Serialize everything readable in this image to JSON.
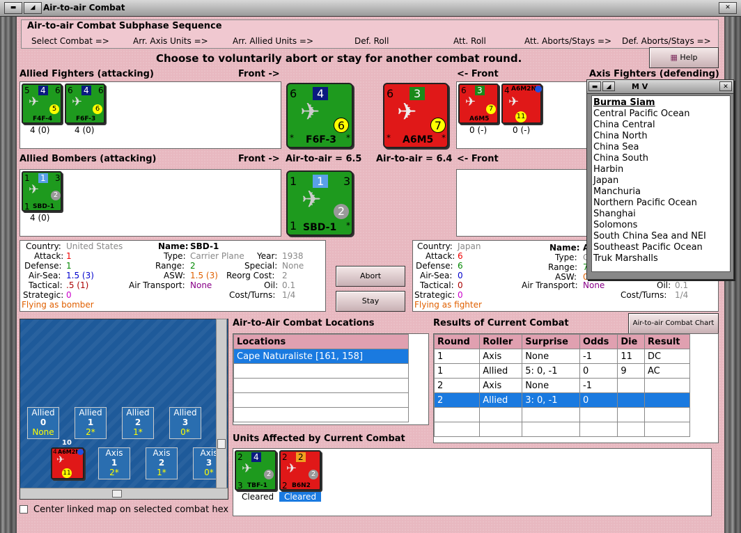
{
  "window": {
    "title": "Air-to-air Combat"
  },
  "subphase": {
    "title": "Air-to-air Combat Subphase Sequence",
    "steps": [
      "Select Combat =>",
      "Arr. Axis Units =>",
      "Arr. Allied Units =>",
      "Def. Roll",
      "Att. Roll",
      "Att. Aborts/Stays =>",
      "Def. Aborts/Stays =>"
    ]
  },
  "prompt": "Choose to voluntarily abort or stay for another combat round.",
  "help_label": "Help",
  "allied_fighters": {
    "label": "Allied Fighters (attacking)",
    "front": "Front ->",
    "units": [
      {
        "name": "F4F-4",
        "tl": "5",
        "tr": "6",
        "badge": "4",
        "circle": "5",
        "count": "4 (0)"
      },
      {
        "name": "F6F-3",
        "tl": "6",
        "tr": "6",
        "badge": "4",
        "circle": "6",
        "count": "4 (0)"
      }
    ],
    "front_unit": {
      "name": "F6F-3",
      "tl": "6",
      "badge": "4",
      "circle": "6",
      "bl": "*",
      "br": "*"
    }
  },
  "axis_fighters": {
    "label": "Axis Fighters (defending)",
    "front": "<- Front",
    "units": [
      {
        "name": "A6M5",
        "tl": "6",
        "badge": "3",
        "circle": "7",
        "count": "0 (-)"
      },
      {
        "name": "A6M2N",
        "tl": "4",
        "circle": "11",
        "count": "0 (-)"
      }
    ],
    "front_unit": {
      "name": "A6M5",
      "tl": "6",
      "badge": "3",
      "circle": "7",
      "bl": "*",
      "br": "*"
    }
  },
  "allied_bombers": {
    "label": "Allied Bombers (attacking)",
    "front": "Front ->",
    "air_to_air": "Air-to-air = 6.5",
    "units": [
      {
        "name": "SBD-1",
        "tl": "1",
        "tr": "3",
        "badge": "1",
        "circle": "2",
        "bl": "1",
        "count": "4 (0)"
      }
    ],
    "front_unit": {
      "name": "SBD-1",
      "tl": "1",
      "tr": "3",
      "badge": "1",
      "circle": "2",
      "bl": "1",
      "br": "*"
    }
  },
  "axis_bombers": {
    "front": "<- Front",
    "air_to_air": "Air-to-air = 6.4"
  },
  "allied_info": {
    "country_label": "Country:",
    "country": "United States",
    "attack_label": "Attack:",
    "attack": "1",
    "defense_label": "Defense:",
    "defense": "1",
    "airsea_label": "Air-Sea:",
    "airsea": "1.5 (3)",
    "tactical_label": "Tactical:",
    "tactical": ".5 (1)",
    "strategic_label": "Strategic:",
    "strategic": "0",
    "flying": "Flying as bomber",
    "name_label": "Name:",
    "name": "SBD-1",
    "type_label": "Type:",
    "type": "Carrier Plane",
    "range_label": "Range:",
    "range": "2",
    "asw_label": "ASW:",
    "asw": "1.5 (3)",
    "air_transport_label": "Air Transport:",
    "air_transport": "None",
    "year_label": "Year:",
    "year": "1938",
    "special_label": "Special:",
    "special": "None",
    "reorg_label": "Reorg Cost:",
    "reorg": "2",
    "oil_label": "Oil:",
    "oil": "0.1",
    "cost_label": "Cost/Turns:",
    "cost": "1/4"
  },
  "axis_info": {
    "country_label": "Country:",
    "country": "Japan",
    "attack_label": "Attack:",
    "attack": "6",
    "defense_label": "Defense:",
    "defense": "6",
    "airsea_label": "Air-Sea:",
    "airsea": "0",
    "tactical_label": "Tactical:",
    "tactical": "0",
    "strategic_label": "Strategic:",
    "strategic": "0",
    "flying": "Flying as fighter",
    "name_label": "Name:",
    "name": "A",
    "type_label": "Type:",
    "type": "C",
    "range_label": "Range:",
    "range": "7",
    "asw_label": "ASW:",
    "asw": "0",
    "air_transport_label": "Air Transport:",
    "air_transport": "None",
    "oil_label": "Oil:",
    "oil": "0.1",
    "cost_label": "Cost/Turns:",
    "cost": "1/4"
  },
  "abort_label": "Abort",
  "stay_label": "Stay",
  "map": {
    "allied_boxes": [
      {
        "label": "Allied",
        "num": "0",
        "sub": "None"
      },
      {
        "label": "Allied",
        "num": "1",
        "sub": "2*"
      },
      {
        "label": "Allied",
        "num": "2",
        "sub": "1*"
      },
      {
        "label": "Allied",
        "num": "3",
        "sub": "0*"
      }
    ],
    "axis_boxes": [
      {
        "label": "Axis",
        "num": "1",
        "sub": "2*"
      },
      {
        "label": "Axis",
        "num": "2",
        "sub": "1*"
      },
      {
        "label": "Axis",
        "num": "3",
        "sub": "0*"
      }
    ],
    "stack_count": "10",
    "unit": {
      "name": "A6M2N",
      "tl": "4",
      "circle": "11"
    }
  },
  "center_map_label": "Center linked map on selected combat hex",
  "locations": {
    "title": "Air-to-Air Combat Locations",
    "header": "Locations",
    "rows": [
      "Cape Naturaliste [161, 158]"
    ]
  },
  "results": {
    "title": "Results of Current Combat",
    "chart_button": "Air-to-air Combat Chart",
    "headers": [
      "Round",
      "Roller",
      "Surprise",
      "Odds",
      "Die",
      "Result"
    ],
    "rows": [
      [
        "1",
        "Axis",
        "None",
        "-1",
        "11",
        "DC"
      ],
      [
        "1",
        "Allied",
        "5: 0, -1",
        "0",
        "9",
        "AC"
      ],
      [
        "2",
        "Axis",
        "None",
        "-1",
        "",
        ""
      ],
      [
        "2",
        "Allied",
        "3: 0, -1",
        "0",
        "",
        ""
      ]
    ]
  },
  "affected": {
    "title": "Units Affected by Current Combat",
    "units": [
      {
        "name": "TBF-1",
        "tl": "2",
        "badge": "4",
        "circle": "2",
        "bl": "3",
        "status": "Cleared"
      },
      {
        "name": "B6N2",
        "tl": "2",
        "badge": "2",
        "circle": "2",
        "bl": "2",
        "status": "Cleared"
      }
    ]
  },
  "popup": {
    "title": "M V",
    "items": [
      "Burma Siam",
      "Central Pacific Ocean",
      "China Central",
      "China North",
      "China Sea",
      "China South",
      "Harbin",
      "Japan",
      "Manchuria",
      "Northern Pacific Ocean",
      "Shanghai",
      "Solomons",
      "South China Sea and NEI",
      "Southeast Pacific Ocean",
      "Truk Marshalls"
    ]
  }
}
